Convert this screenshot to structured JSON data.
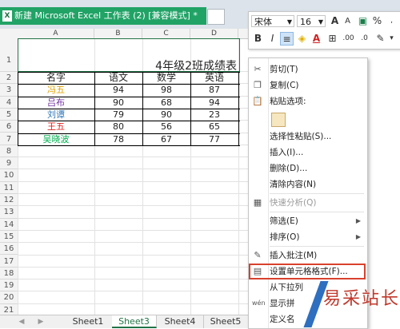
{
  "window": {
    "doc_tab_title": "新建 Microsoft Excel 工作表 (2)  [兼容模式] *",
    "app_icon": "X"
  },
  "sheet": {
    "columns": [
      "A",
      "B",
      "C",
      "D"
    ],
    "rows": [
      "1",
      "2",
      "3",
      "4",
      "5",
      "6",
      "7",
      "8",
      "9",
      "10",
      "11",
      "12",
      "13",
      "14",
      "15",
      "16",
      "17",
      "18",
      "19",
      "20",
      "21"
    ],
    "title": "4年级2班成绩表",
    "headers": [
      "名字",
      "语文",
      "数学",
      "英语"
    ],
    "data": [
      {
        "name": "冯五",
        "color": "#e0a000",
        "v": [
          "94",
          "98",
          "87"
        ]
      },
      {
        "name": "吕布",
        "color": "#7030a0",
        "v": [
          "90",
          "68",
          "94"
        ]
      },
      {
        "name": "刘谭",
        "color": "#2e75b6",
        "v": [
          "79",
          "90",
          "23"
        ]
      },
      {
        "name": "王五",
        "color": "#e02020",
        "v": [
          "80",
          "56",
          "65"
        ]
      },
      {
        "name": "吴晓波",
        "color": "#00b050",
        "v": [
          "78",
          "67",
          "77"
        ]
      }
    ]
  },
  "tabs": {
    "items": [
      "Sheet1",
      "Sheet3",
      "Sheet4",
      "Sheet5"
    ],
    "active": "Sheet3"
  },
  "mini_toolbar": {
    "font": "宋体",
    "size": "16",
    "grow": "A",
    "shrink": "A",
    "currency": "$",
    "percent": "%"
  },
  "context_menu": {
    "items": [
      {
        "label": "剪切(T)",
        "icon": "scissors-icon",
        "glyph": "✂"
      },
      {
        "label": "复制(C)",
        "icon": "copy-icon",
        "glyph": "❐"
      },
      {
        "label": "粘贴选项:",
        "icon": "paste-icon",
        "glyph": "📋"
      },
      {
        "label": "",
        "icon": "paste-option-icon",
        "glyph": ""
      },
      {
        "label": "选择性粘贴(S)...",
        "icon": "",
        "glyph": ""
      },
      {
        "label": "插入(I)...",
        "icon": "",
        "glyph": ""
      },
      {
        "label": "删除(D)...",
        "icon": "",
        "glyph": ""
      },
      {
        "label": "清除内容(N)",
        "icon": "",
        "glyph": ""
      },
      {
        "label": "快速分析(Q)",
        "icon": "quick-analysis-icon",
        "glyph": "▦",
        "disabled": true
      },
      {
        "label": "筛选(E)",
        "icon": "",
        "glyph": "",
        "submenu": true
      },
      {
        "label": "排序(O)",
        "icon": "",
        "glyph": "",
        "submenu": true
      },
      {
        "label": "插入批注(M)",
        "icon": "comment-icon",
        "glyph": "✎"
      },
      {
        "label": "设置单元格格式(F)...",
        "icon": "format-cells-icon",
        "glyph": "▤",
        "highlight": true
      },
      {
        "label": "从下拉列",
        "icon": "",
        "glyph": ""
      },
      {
        "label": "显示拼",
        "icon": "phonetic-icon",
        "glyph": "wén"
      },
      {
        "label": "定义名",
        "icon": "",
        "glyph": ""
      }
    ]
  },
  "watermark": {
    "text": "易采站长站",
    "sub": ""
  }
}
